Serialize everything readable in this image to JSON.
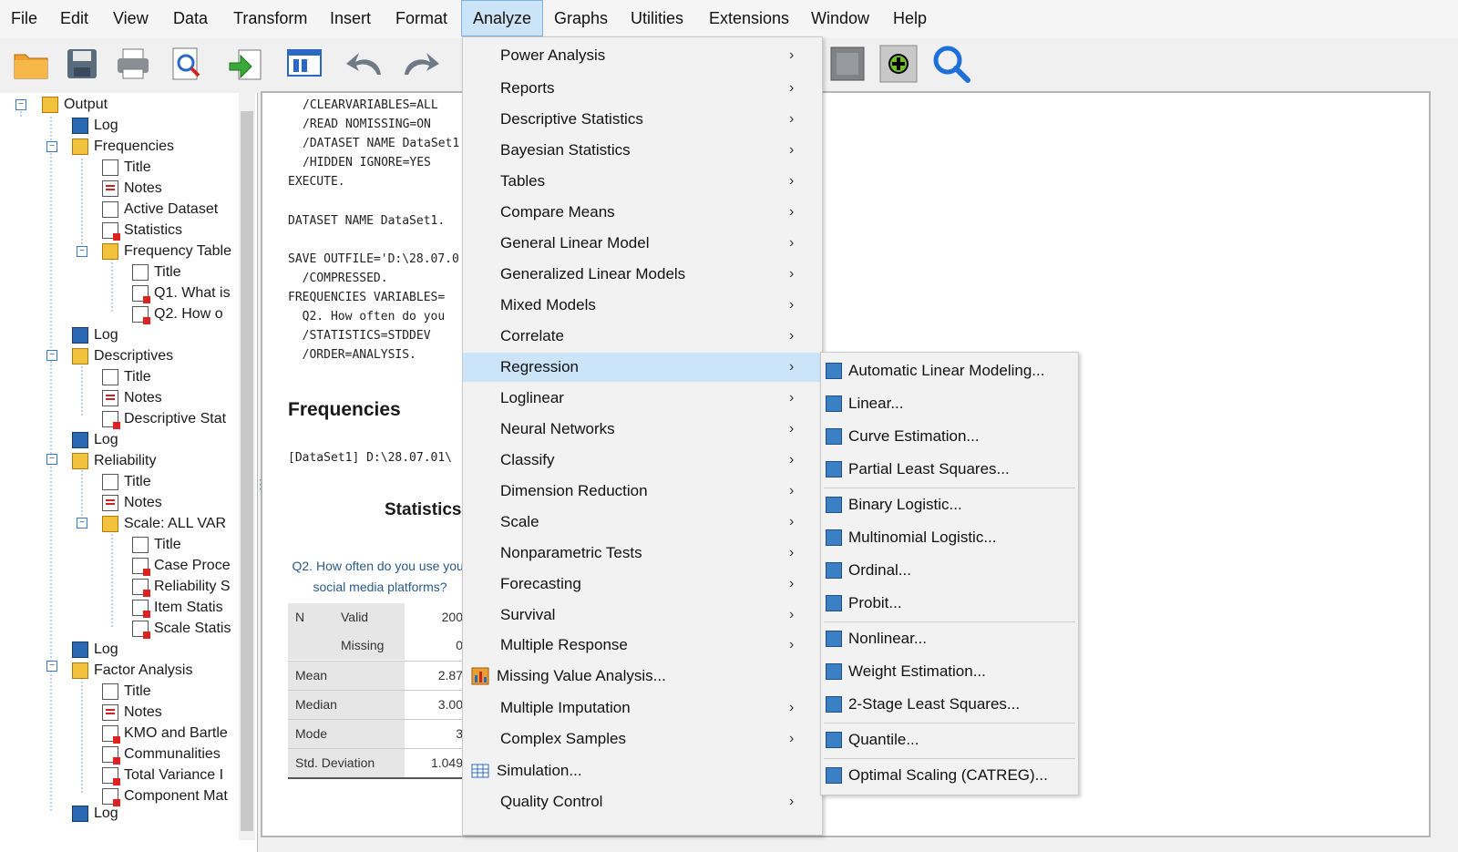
{
  "menubar": [
    "File",
    "Edit",
    "View",
    "Data",
    "Transform",
    "Insert",
    "Format",
    "Analyze",
    "Graphs",
    "Utilities",
    "Extensions",
    "Window",
    "Help"
  ],
  "tree": [
    "Output",
    "Log",
    "Frequencies",
    "Title",
    "Notes",
    "Active Dataset",
    "Statistics",
    "Frequency Table",
    "Title",
    "Q1. What is",
    "Q2. How o",
    "Log",
    "Descriptives",
    "Title",
    "Notes",
    "Descriptive Stat",
    "Log",
    "Reliability",
    "Title",
    "Notes",
    "Scale: ALL VAR",
    "Title",
    "Case Proce",
    "Reliability S",
    "Item Statis",
    "Scale Statis",
    "Log",
    "Factor Analysis",
    "Title",
    "Notes",
    "KMO and Bartle",
    "Communalities",
    "Total Variance I",
    "Component Mat",
    "Log"
  ],
  "syntax": [
    "/CLEARVARIABLES=ALL",
    "/READ NOMISSING=ON",
    "/DATASET NAME DataSet1",
    "/HIDDEN IGNORE=YES",
    "EXECUTE.",
    "DATASET NAME DataSet1.",
    "SAVE OUTFILE='D:\\28.07.0",
    "  /COMPRESSED.",
    "FREQUENCIES VARIABLES=",
    "  Q2. How often do you",
    "  /STATISTICS=STDDEV",
    "  /ORDER=ANALYSIS."
  ],
  "output": {
    "heading": "Frequencies",
    "dataset_line": "[DataSet1] D:\\28.07.01\\",
    "stats_title": "Statistics",
    "caption": "Q2. How often do you use your social media platforms?",
    "rows": [
      [
        "N",
        "Valid",
        "200"
      ],
      [
        "",
        "Missing",
        "0"
      ],
      [
        "Mean",
        "",
        "2.87"
      ],
      [
        "Median",
        "",
        "3.00"
      ],
      [
        "Mode",
        "",
        "3"
      ],
      [
        "Std. Deviation",
        "",
        "1.049"
      ]
    ]
  },
  "analyze_menu": [
    "Power Analysis",
    "Reports",
    "Descriptive Statistics",
    "Bayesian Statistics",
    "Tables",
    "Compare Means",
    "General Linear Model",
    "Generalized Linear Models",
    "Mixed Models",
    "Correlate",
    "Regression",
    "Loglinear",
    "Neural Networks",
    "Classify",
    "Dimension Reduction",
    "Scale",
    "Nonparametric Tests",
    "Forecasting",
    "Survival",
    "Multiple Response",
    "Missing Value Analysis...",
    "Multiple Imputation",
    "Complex Samples",
    "Simulation...",
    "Quality Control"
  ],
  "regression_submenu": [
    "Automatic Linear Modeling...",
    "Linear...",
    "Curve Estimation...",
    "Partial Least Squares...",
    "Binary Logistic...",
    "Multinomial Logistic...",
    "Ordinal...",
    "Probit...",
    "Nonlinear...",
    "Weight Estimation...",
    "2-Stage Least Squares...",
    "Quantile...",
    "Optimal Scaling (CATREG)..."
  ]
}
